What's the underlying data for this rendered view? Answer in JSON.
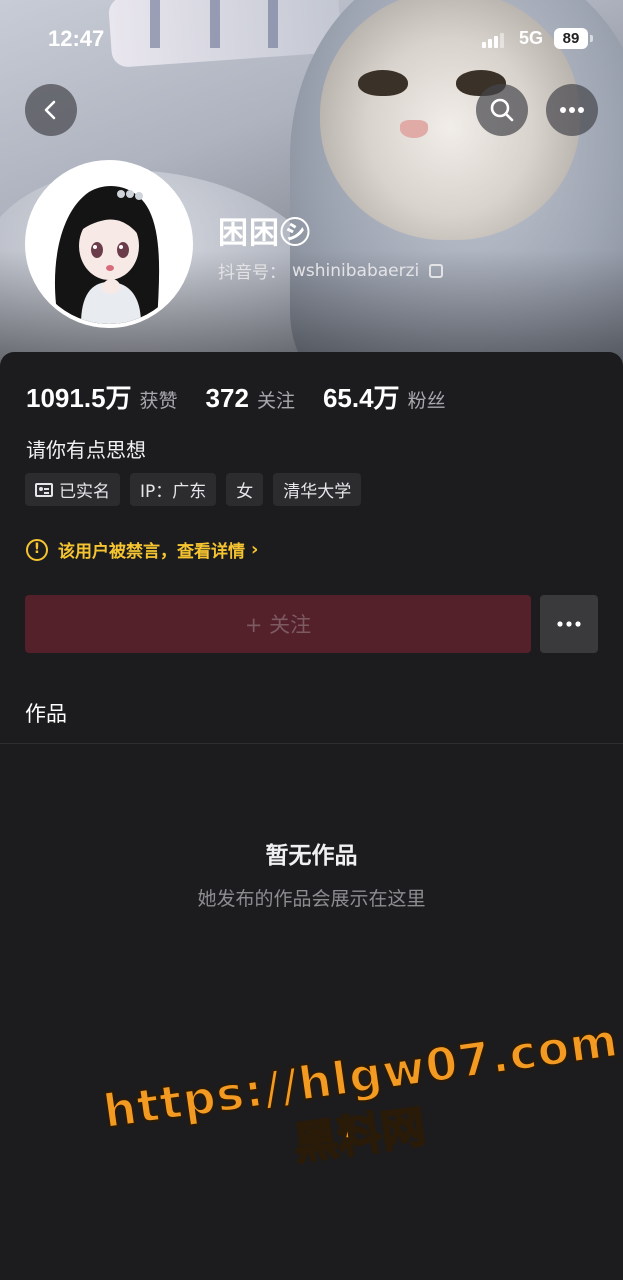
{
  "status_bar": {
    "time": "12:47",
    "network": "5G",
    "battery": "89"
  },
  "profile": {
    "name": "困困㋛",
    "id_label": "抖音号：",
    "id_value": "wshinibabaerzi",
    "bio": "请你有点思想"
  },
  "stats": [
    {
      "value": "1091.5万",
      "label": "获赞"
    },
    {
      "value": "372",
      "label": "关注"
    },
    {
      "value": "65.4万",
      "label": "粉丝"
    }
  ],
  "tags": [
    "已实名",
    "IP：广东",
    "女",
    "清华大学"
  ],
  "notice": {
    "text": "该用户被禁言，查看详情",
    "color": "#f5c430"
  },
  "actions": {
    "follow_label": "+ 关注",
    "follow_color": "#54202a"
  },
  "tabs": {
    "works_label": "作品"
  },
  "empty_state": {
    "title": "暂无作品",
    "subtitle": "她发布的作品会展示在这里"
  },
  "watermark": {
    "url": "https://hlgw07.com",
    "name": "黑料网"
  },
  "icons": [
    "back-arrow-icon",
    "search-icon",
    "more-dots-icon",
    "copy-icon",
    "id-card-icon",
    "warning-icon",
    "chevron-right-icon"
  ]
}
